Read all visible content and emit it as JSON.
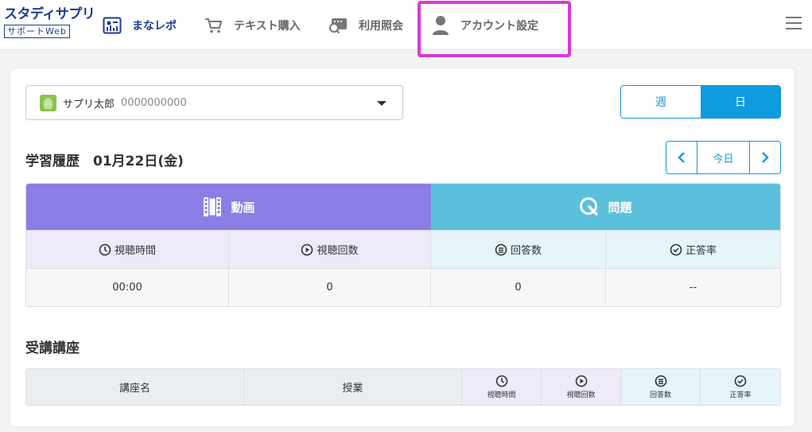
{
  "header": {
    "logo_main": "スタディサプリ",
    "logo_sub": "サポートWeb",
    "nav": [
      {
        "label": "まなレポ",
        "icon": "report-icon"
      },
      {
        "label": "テキスト購入",
        "icon": "cart-icon"
      },
      {
        "label": "利用照会",
        "icon": "usage-icon"
      },
      {
        "label": "アカウント設定",
        "icon": "person-icon"
      }
    ],
    "menu_icon": "hamburger-icon"
  },
  "user_select": {
    "name": "サプリ太郎",
    "id": "0000000000"
  },
  "period_toggle": {
    "week": "週",
    "day": "日",
    "selected": "日"
  },
  "history": {
    "title": "学習履歴　01月22日(金)",
    "today_label": "今日"
  },
  "stats": {
    "video_header": "動画",
    "quiz_header": "問題",
    "columns": [
      "視聴時間",
      "視聴回数",
      "回答数",
      "正答率"
    ],
    "values": [
      "00:00",
      "0",
      "0",
      "--"
    ]
  },
  "courses": {
    "title": "受講講座",
    "columns": [
      "講座名",
      "授業",
      "視聴時間",
      "視聴回数",
      "回答数",
      "正答率"
    ]
  },
  "colors": {
    "brand": "#1e3c8c",
    "accent": "#0f9be0",
    "video": "#8a7de6",
    "quiz": "#5bc0dc",
    "highlight": "#d63ad2"
  }
}
